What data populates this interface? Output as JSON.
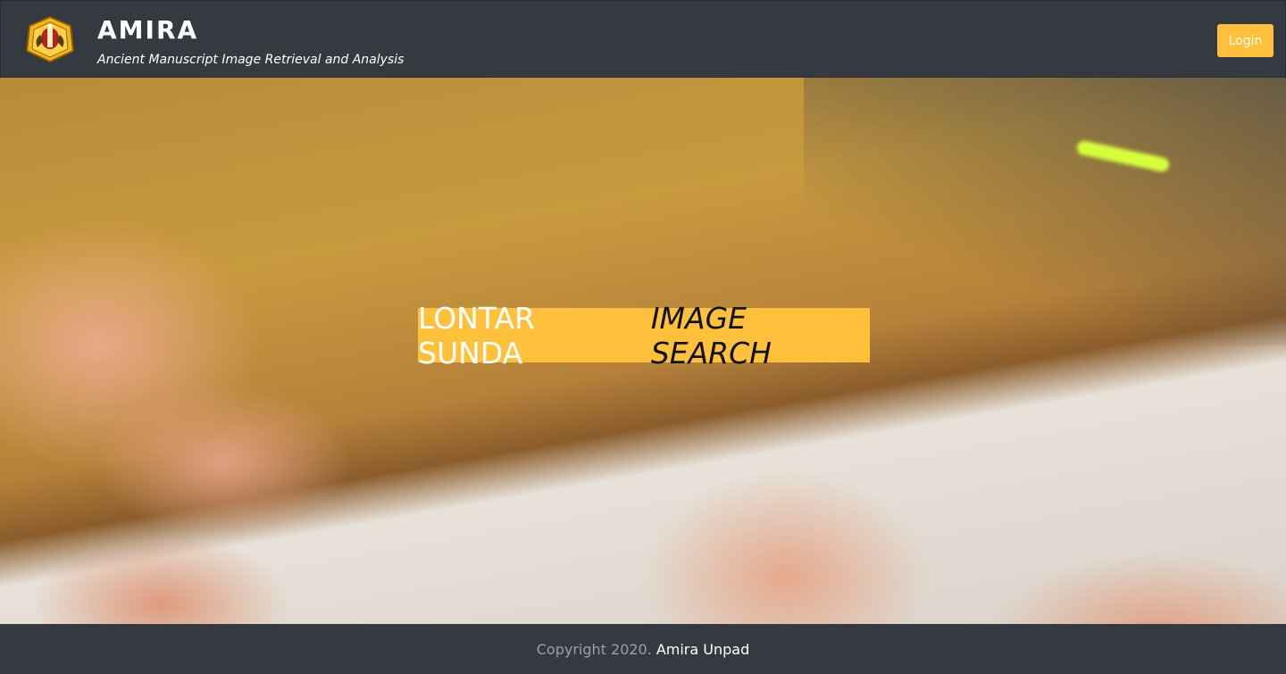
{
  "header": {
    "title": "AMIRA",
    "subtitle": "Ancient Manuscript Image Retrieval and Analysis",
    "login_label": "Login",
    "logo_icon": "university-emblem-icon"
  },
  "hero": {
    "title_light": "LONTAR SUNDA",
    "title_dark": "IMAGE SEARCH"
  },
  "footer": {
    "copyright": "Copyright 2020.",
    "owner": "Amira Unpad"
  },
  "colors": {
    "navbar": "#343a40",
    "accent": "#ffc13b"
  }
}
